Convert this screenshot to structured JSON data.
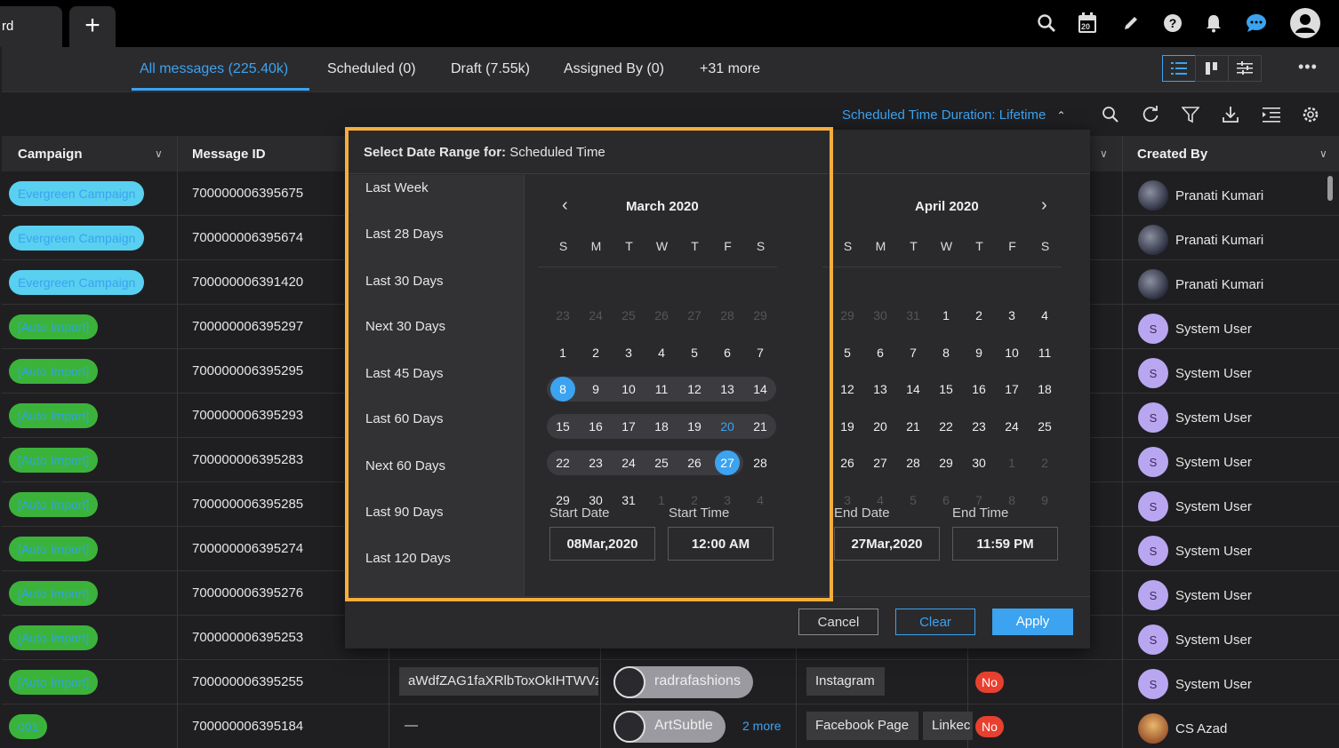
{
  "app": {
    "tab_current_label": "rd",
    "tab_add_label": "+",
    "calendar_badge": "20"
  },
  "message_tabs": [
    {
      "label": "All messages (225.40k)",
      "active": true
    },
    {
      "label": "Scheduled (0)",
      "active": false
    },
    {
      "label": "Draft (7.55k)",
      "active": false
    },
    {
      "label": "Assigned By (0)",
      "active": false
    },
    {
      "label": "+31 more",
      "active": false
    }
  ],
  "filter": {
    "label": "Scheduled Time Duration: Lifetime"
  },
  "table": {
    "headers": {
      "campaign": "Campaign",
      "message_id": "Message ID",
      "created_by": "Created By"
    },
    "rows": [
      {
        "campaign": "Evergreen Campaign",
        "type": "evergreen",
        "id": "700000006395675",
        "creator": "Pranati Kumari",
        "avatar": "photo",
        "initial": ""
      },
      {
        "campaign": "Evergreen Campaign",
        "type": "evergreen",
        "id": "700000006395674",
        "creator": "Pranati Kumari",
        "avatar": "photo",
        "initial": ""
      },
      {
        "campaign": "Evergreen Campaign",
        "type": "evergreen",
        "id": "700000006391420",
        "creator": "Pranati Kumari",
        "avatar": "photo",
        "initial": ""
      },
      {
        "campaign": "[Auto Import]",
        "type": "auto",
        "id": "700000006395297",
        "creator": "System User",
        "avatar": "s",
        "initial": "S"
      },
      {
        "campaign": "[Auto Import]",
        "type": "auto",
        "id": "700000006395295",
        "creator": "System User",
        "avatar": "s",
        "initial": "S"
      },
      {
        "campaign": "[Auto Import]",
        "type": "auto",
        "id": "700000006395293",
        "creator": "System User",
        "avatar": "s",
        "initial": "S"
      },
      {
        "campaign": "[Auto Import]",
        "type": "auto",
        "id": "700000006395283",
        "creator": "System User",
        "avatar": "s",
        "initial": "S"
      },
      {
        "campaign": "[Auto Import]",
        "type": "auto",
        "id": "700000006395285",
        "creator": "System User",
        "avatar": "s",
        "initial": "S"
      },
      {
        "campaign": "[Auto Import]",
        "type": "auto",
        "id": "700000006395274",
        "creator": "System User",
        "avatar": "s",
        "initial": "S"
      },
      {
        "campaign": "[Auto Import]",
        "type": "auto",
        "id": "700000006395276",
        "creator": "System User",
        "avatar": "s",
        "initial": "S"
      },
      {
        "campaign": "[Auto Import]",
        "type": "auto",
        "id": "700000006395253",
        "creator": "System User",
        "avatar": "s",
        "initial": "S"
      },
      {
        "campaign": "[Auto Import]",
        "type": "auto",
        "id": "700000006395255",
        "creator": "System User",
        "avatar": "s",
        "initial": "S"
      },
      {
        "campaign": "001",
        "type": "num",
        "id": "700000006395184",
        "creator": "CS Azad",
        "avatar": "cs",
        "initial": ""
      }
    ],
    "row12_extra": {
      "content": "aWdfZAG1faXRlbToxOkIHTWVz",
      "account": "radrafashions",
      "channel": "Instagram",
      "flag": "No"
    },
    "row13_extra": {
      "content": "—",
      "account": "ArtSubtle",
      "more": "2 more",
      "channel": "Facebook Page",
      "channel2": "Linkec",
      "flag": "No"
    }
  },
  "date_picker": {
    "header_bold": "Select Date Range for:",
    "header_rest": " Scheduled Time",
    "presets": [
      "Last Week",
      "Last 28 Days",
      "Last 30 Days",
      "Next 30 Days",
      "Last 45 Days",
      "Last 60 Days",
      "Next 60 Days",
      "Last 90 Days",
      "Last 120 Days"
    ],
    "weekdays": [
      "S",
      "M",
      "T",
      "W",
      "T",
      "F",
      "S"
    ],
    "left_month": {
      "title": "March 2020",
      "weeks": [
        [
          "23",
          "24",
          "25",
          "26",
          "27",
          "28",
          "29"
        ],
        [
          "1",
          "2",
          "3",
          "4",
          "5",
          "6",
          "7"
        ],
        [
          "8",
          "9",
          "10",
          "11",
          "12",
          "13",
          "14"
        ],
        [
          "15",
          "16",
          "17",
          "18",
          "19",
          "20",
          "21"
        ],
        [
          "22",
          "23",
          "24",
          "25",
          "26",
          "27",
          "28"
        ],
        [
          "29",
          "30",
          "31",
          "1",
          "2",
          "3",
          "4"
        ]
      ],
      "muted_first_week": true,
      "muted_last_week_from": 3
    },
    "right_month": {
      "title": "April 2020",
      "weeks": [
        [
          "29",
          "30",
          "31",
          "1",
          "2",
          "3",
          "4"
        ],
        [
          "5",
          "6",
          "7",
          "8",
          "9",
          "10",
          "11"
        ],
        [
          "12",
          "13",
          "14",
          "15",
          "16",
          "17",
          "18"
        ],
        [
          "19",
          "20",
          "21",
          "22",
          "23",
          "24",
          "25"
        ],
        [
          "26",
          "27",
          "28",
          "29",
          "30",
          "1",
          "2"
        ],
        [
          "3",
          "4",
          "5",
          "6",
          "7",
          "8",
          "9"
        ]
      ]
    },
    "start_date_label": "Start Date",
    "start_time_label": "Start Time",
    "end_date_label": "End Date",
    "end_time_label": "End Time",
    "start_date": "08Mar,2020",
    "start_time": "12:00 AM",
    "end_date": "27Mar,2020",
    "end_time": "11:59 PM",
    "cancel_label": "Cancel",
    "clear_label": "Clear",
    "apply_label": "Apply"
  },
  "colors": {
    "accent": "#3ba3f0",
    "highlight": "#f5ad3c",
    "no_badge": "#e8402f"
  }
}
